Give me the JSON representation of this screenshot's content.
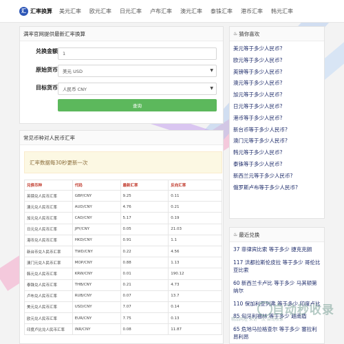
{
  "header": {
    "logo_text": "汇率换算",
    "logo_mark": "汇",
    "nav": [
      "美元汇率",
      "欧元汇率",
      "日元汇率",
      "卢布汇率",
      "澳元汇率",
      "泰铢汇率",
      "港币汇率",
      "韩元汇率"
    ]
  },
  "converter": {
    "title": "满率官网提供最新汇率换算",
    "amount_label": "兑换金额",
    "amount_value": "1",
    "source_label": "原始货币",
    "source_value": "美元 USD",
    "target_label": "目标货币",
    "target_value": "人民币 CNY",
    "submit_label": "查询"
  },
  "rates": {
    "title": "常见币种对人民币汇率",
    "notice": "汇率数据每30秒更新一次",
    "headers": [
      "兑换币种",
      "代码",
      "最新汇率",
      "反向汇率"
    ],
    "rows": [
      [
        "英镑兑人民币汇率",
        "GBP/CNY",
        "9.25",
        "0.11"
      ],
      [
        "澳元兑人民币汇率",
        "AUD/CNY",
        "4.76",
        "0.21"
      ],
      [
        "加元兑人民币汇率",
        "CAD/CNY",
        "5.17",
        "0.19"
      ],
      [
        "日元兑人民币汇率",
        "JPY/CNY",
        "0.05",
        "21.03"
      ],
      [
        "港币兑人民币汇率",
        "HKD/CNY",
        "0.91",
        "1.1"
      ],
      [
        "新台币兑人民币汇率",
        "TWD/CNY",
        "0.22",
        "4.56"
      ],
      [
        "澳门元兑人民币汇率",
        "MOP/CNY",
        "0.88",
        "1.13"
      ],
      [
        "韩元兑人民币汇率",
        "KRW/CNY",
        "0.01",
        "190.12"
      ],
      [
        "泰铢兑人民币汇率",
        "THB/CNY",
        "0.21",
        "4.73"
      ],
      [
        "卢布兑人民币汇率",
        "RUB/CNY",
        "0.07",
        "13.7"
      ],
      [
        "美元兑人民币汇率",
        "USD/CNY",
        "7.07",
        "0.14"
      ],
      [
        "欧元兑人民币汇率",
        "EUR/CNY",
        "7.75",
        "0.13"
      ],
      [
        "印度卢比兑人民币汇率",
        "INR/CNY",
        "0.08",
        "11.87"
      ]
    ]
  },
  "likes": {
    "title": "猜你喜欢",
    "items": [
      "美元等于多少人民币?",
      "欧元等于多少人民币?",
      "英镑等于多少人民币?",
      "澳元等于多少人民币?",
      "加元等于多少人民币?",
      "日元等于多少人民币?",
      "港币等于多少人民币?",
      "新台币等于多少人民币?",
      "澳门元等于多少人民币?",
      "韩元等于多少人民币?",
      "泰铢等于多少人民币?",
      "新西兰元等于多少人民币?",
      "俄罗斯卢布等于多少人民币?"
    ]
  },
  "recent": {
    "title": "最近兑换",
    "items": [
      "37 菲律宾比索 等于多少 捷克克朗",
      "117 洪都拉斯伦皮拉 等于多少 哥伦比亚比索",
      "60 新西兰卡卢比 等于多少 马其顿第纳尔",
      "110 保加利亚列弗 等于多少 印度卢比",
      "85 匈牙利福林 等于多少 越南盾",
      "65 危地马拉格查尔 等于多少 塞拉利昂利昂"
    ]
  },
  "watermark": {
    "big": "自动秒收录",
    "small": "精品网址·来访一次·自动收录"
  }
}
